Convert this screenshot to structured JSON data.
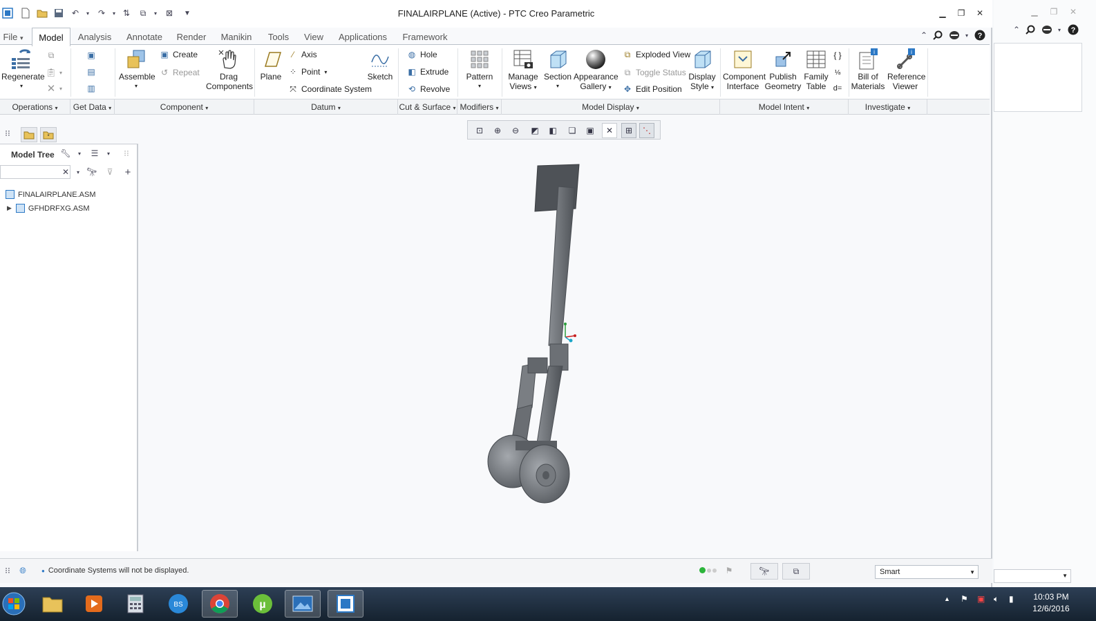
{
  "window": {
    "title": "FINALAIRPLANE (Active) - PTC Creo Parametric"
  },
  "tabs": [
    {
      "label": "File",
      "arrow": "▾"
    },
    {
      "label": "Model"
    },
    {
      "label": "Analysis"
    },
    {
      "label": "Annotate"
    },
    {
      "label": "Render"
    },
    {
      "label": "Manikin"
    },
    {
      "label": "Tools"
    },
    {
      "label": "View"
    },
    {
      "label": "Applications"
    },
    {
      "label": "Framework"
    }
  ],
  "ribbon": {
    "regenerate": "Regenerate",
    "assemble": "Assemble",
    "create": "Create",
    "repeat": "Repeat",
    "drag": [
      "Drag",
      "Components"
    ],
    "plane": "Plane",
    "axis": "Axis",
    "point": "Point",
    "coord": "Coordinate System",
    "sketch": "Sketch",
    "hole": "Hole",
    "extrude": "Extrude",
    "revolve": "Revolve",
    "pattern": "Pattern",
    "manage_views": [
      "Manage",
      "Views"
    ],
    "section": "Section",
    "appearance": [
      "Appearance",
      "Gallery"
    ],
    "exploded": "Exploded View",
    "toggle": "Toggle Status",
    "edit_position": "Edit Position",
    "display_style": [
      "Display",
      "Style"
    ],
    "component_interface": [
      "Component",
      "Interface"
    ],
    "publish_geometry": [
      "Publish",
      "Geometry"
    ],
    "family_table": [
      "Family",
      "Table"
    ],
    "bom": [
      "Bill of",
      "Materials"
    ],
    "ref_viewer": [
      "Reference",
      "Viewer"
    ]
  },
  "groups": [
    "Operations",
    "Get Data",
    "Component",
    "Datum",
    "Cut & Surface",
    "Modifiers",
    "Model Display",
    "Model Intent",
    "Investigate"
  ],
  "tree": {
    "header": "Model Tree",
    "items": [
      {
        "label": "FINALAIRPLANE.ASM"
      },
      {
        "label": "GFHDRFXG.ASM"
      }
    ]
  },
  "status": {
    "message": "Coordinate Systems will not be displayed.",
    "filter": "Smart"
  },
  "clock": {
    "time": "10:03 PM",
    "date": "12/6/2016"
  },
  "colors": {
    "accent": "#2b78c5",
    "model_gray": "#6f7378",
    "taskbar": "#1d2c3c"
  }
}
